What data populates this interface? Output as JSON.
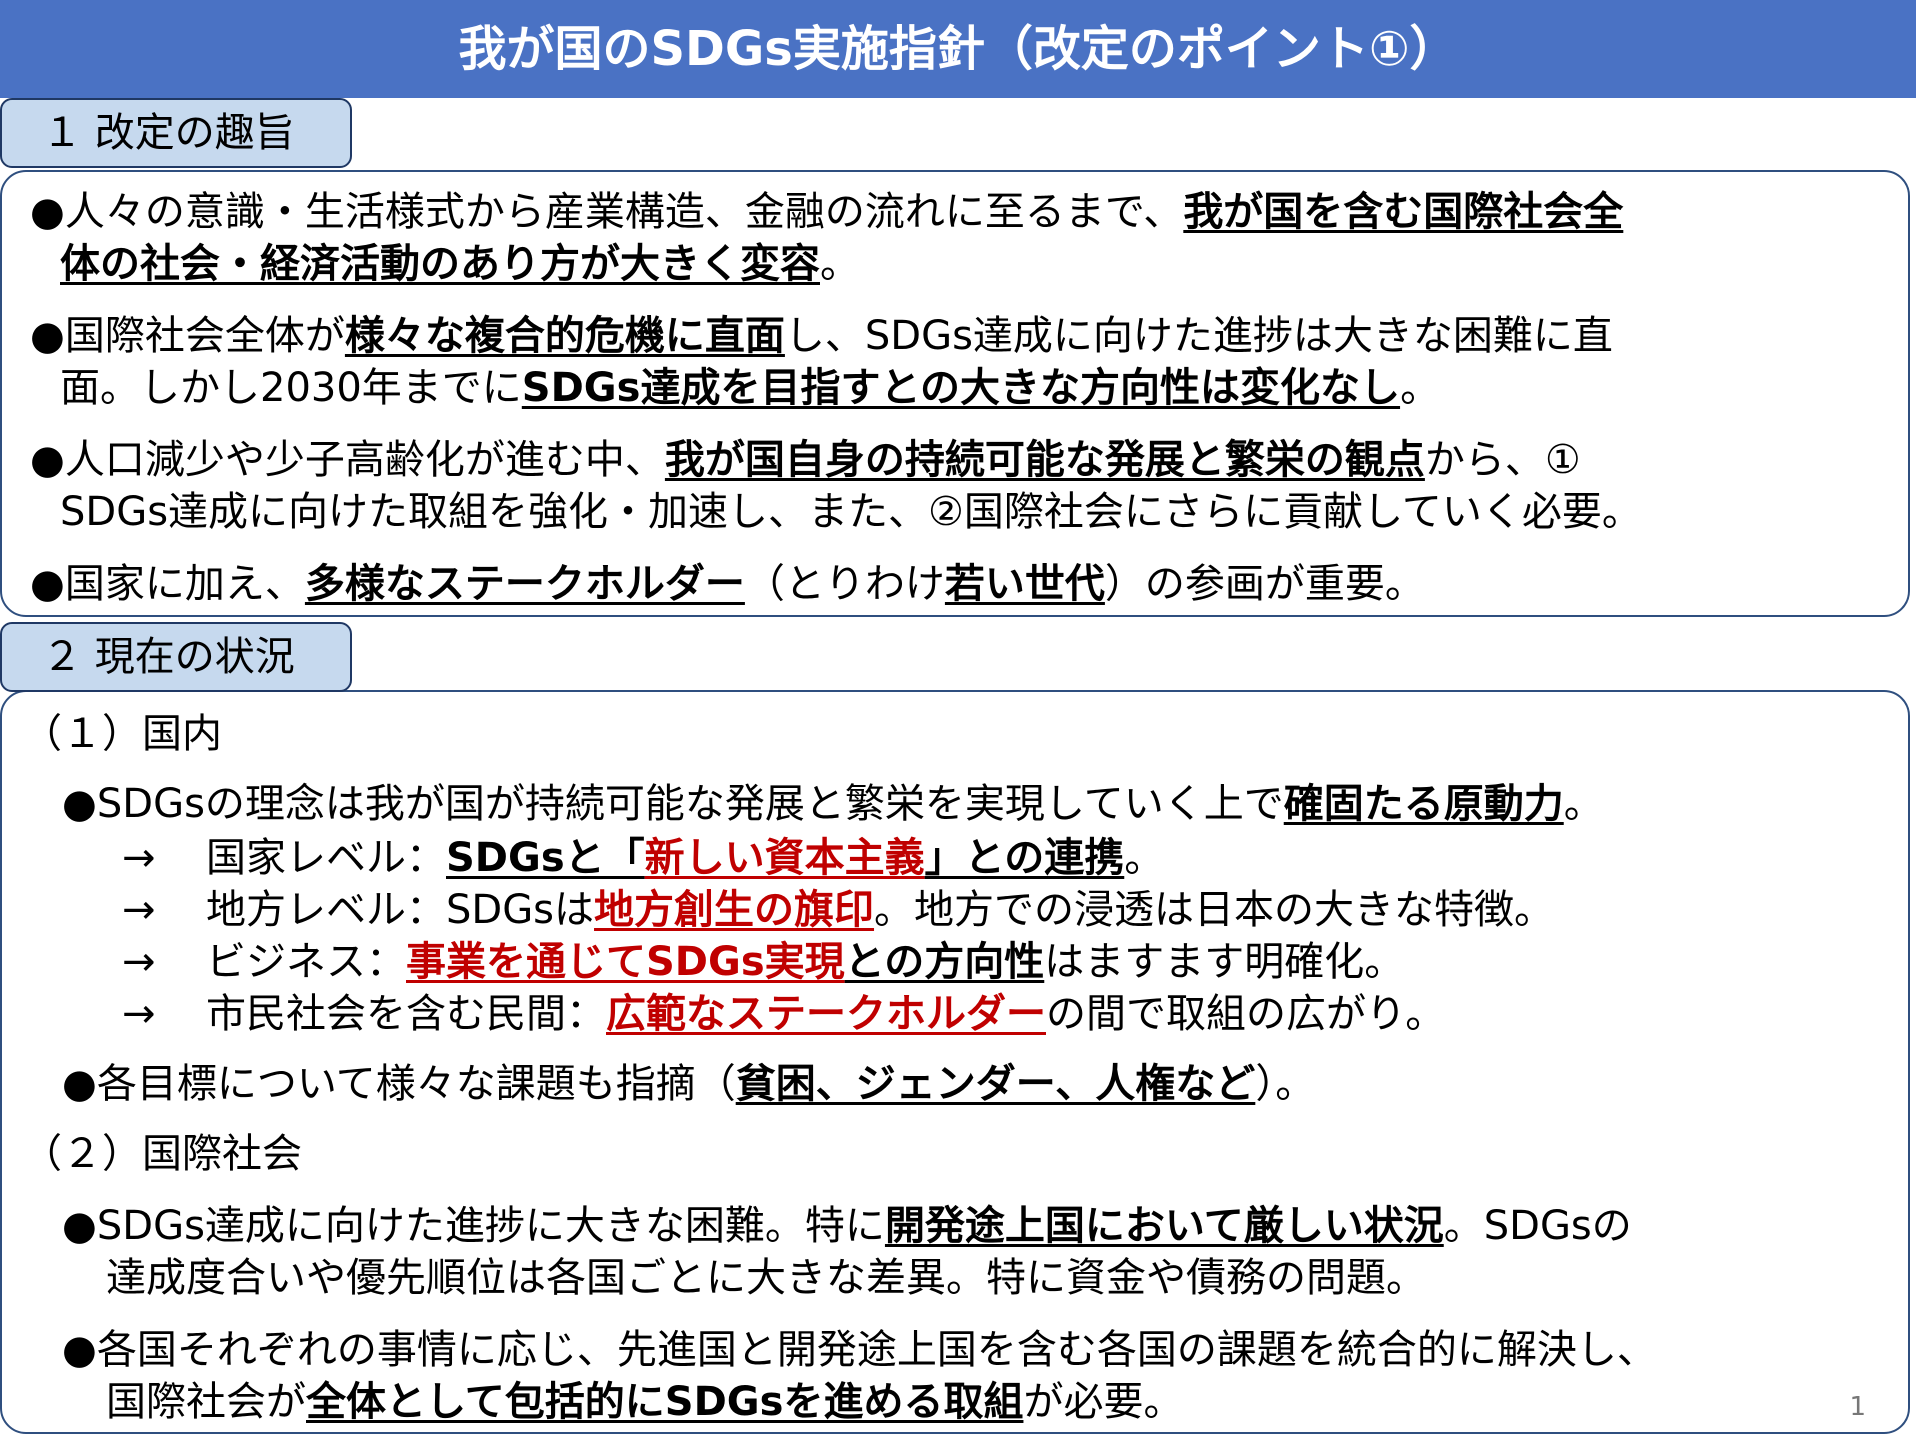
{
  "title": "我が国のSDGs実施指針（改定のポイント①）",
  "section1": {
    "heading": "１ 改定の趣旨",
    "b1": {
      "t1": "●人々の意識・生活様式から産業構造、金融の流れに至るまで、",
      "t2": "我が国を含む国際社会全",
      "t3": "体の社会・経済活動のあり方が大きく変容",
      "t4": "。"
    },
    "b2": {
      "t1": "●国際社会全体が",
      "t2": "様々な複合的危機に直面",
      "t3": "し、SDGs達成に向けた進捗は大きな困難に直",
      "t4": "面。しかし2030年までに",
      "t5": "SDGs達成を目指すとの大きな方向性は変化なし",
      "t6": "。"
    },
    "b3": {
      "t1": "●人口減少や少子高齢化が進む中、",
      "t2": "我が国自身の持続可能な発展と繁栄の観点",
      "t3": "から、①",
      "t4": "SDGs達成に向けた取組を強化・加速し、また、②国際社会にさらに貢献していく必要。"
    },
    "b4": {
      "t1": "●国家に加え、",
      "t2": "多様なステークホルダー",
      "t3": "（とりわけ",
      "t4": "若い世代",
      "t5": "）の参画が重要。"
    }
  },
  "section2": {
    "heading": "２ 現在の状況",
    "sub1": "（１）国内",
    "d1": {
      "t1": "●SDGsの理念は我が国が持続可能な発展と繁栄を実現していく上で",
      "t2": "確固たる原動力",
      "t3": "。"
    },
    "a1": {
      "arrow": "→",
      "t1": "国家レベル：",
      "t2": "SDGsと「",
      "t3": "新しい資本主義",
      "t4": "」との連携",
      "t5": "。"
    },
    "a2": {
      "arrow": "→",
      "t1": "地方レベル：SDGsは",
      "t2": "地方創生の旗印",
      "t3": "。地方での浸透は日本の大きな特徴。"
    },
    "a3": {
      "arrow": "→",
      "t1": "ビジネス：",
      "t2": "事業を通じてSDGs実現",
      "t3": "との方向性",
      "t4": "はますます明確化。"
    },
    "a4": {
      "arrow": "→",
      "t1": "市民社会を含む民間：",
      "t2": "広範なステークホルダー",
      "t3": "の間で取組の広がり。"
    },
    "d2": {
      "t1": "●各目標について様々な課題も指摘（",
      "t2": "貧困、ジェンダー、人権など",
      "t3": "）。"
    },
    "sub2": "（２）国際社会",
    "i1": {
      "t1": "●SDGs達成に向けた進捗に大きな困難。特に",
      "t2": "開発途上国において厳しい状況",
      "t3": "。SDGsの",
      "t4": "達成度合いや優先順位は各国ごとに大きな差異。特に資金や債務の問題。"
    },
    "i2": {
      "t1": "●各国それぞれの事情に応じ、先進国と開発途上国を含む各国の課題を統合的に解決し、",
      "t2": "国際社会が",
      "t3": "全体として包括的にSDGsを進める取組",
      "t4": "が必要。"
    }
  },
  "page_number": "1",
  "colors": {
    "title_bg": "#4a72c4",
    "section_head_bg": "#c6d9ee",
    "accent_red": "#c00000"
  }
}
